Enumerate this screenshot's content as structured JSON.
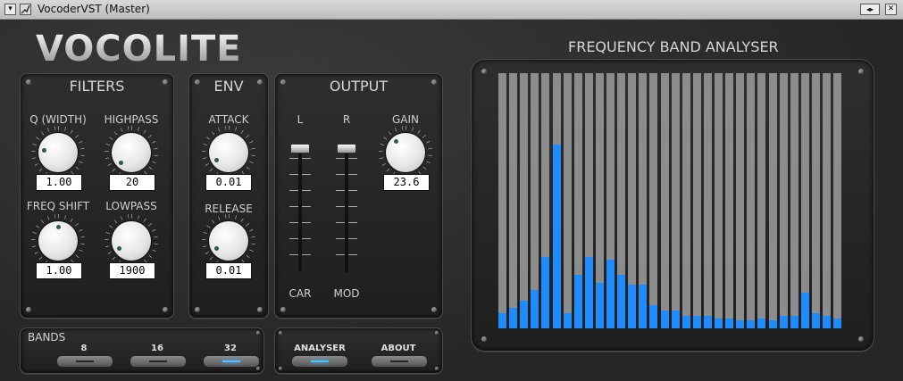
{
  "window": {
    "title": "VocoderVST (Master)",
    "menu_glyph": "▾",
    "resize_glyph": "◂▸",
    "close_glyph": "✕"
  },
  "logo": "VOCOLITE",
  "filters": {
    "title": "FILTERS",
    "q_label": "Q (WIDTH)",
    "q_value": "1.00",
    "q_level": 0.2,
    "highpass_label": "HIGHPASS",
    "highpass_value": "20",
    "highpass_level": 0.0,
    "freqshift_label": "FREQ SHIFT",
    "freqshift_value": "1.00",
    "freqshift_level": 0.5,
    "lowpass_label": "LOWPASS",
    "lowpass_value": "1900",
    "lowpass_level": 0.05
  },
  "env": {
    "title": "ENV",
    "attack_label": "ATTACK",
    "attack_value": "0.01",
    "attack_level": 0.05,
    "release_label": "RELEASE",
    "release_value": "0.01",
    "release_level": 0.05
  },
  "output": {
    "title": "OUTPUT",
    "l_label": "L",
    "r_label": "R",
    "gain_label": "GAIN",
    "gain_value": "23.6",
    "gain_level": 0.35,
    "car_label": "CAR",
    "mod_label": "MOD",
    "l_level": 1.0,
    "r_level": 1.0
  },
  "bands": {
    "title": "BANDS",
    "options": [
      "8",
      "16",
      "32"
    ],
    "selected": "32"
  },
  "view": {
    "analyser_label": "ANALYSER",
    "about_label": "ABOUT",
    "selected": "ANALYSER"
  },
  "analyser": {
    "title": "FREQUENCY BAND ANALYSER",
    "band_levels": [
      0.06,
      0.08,
      0.11,
      0.15,
      0.28,
      0.72,
      0.06,
      0.21,
      0.28,
      0.18,
      0.27,
      0.21,
      0.17,
      0.17,
      0.09,
      0.07,
      0.07,
      0.05,
      0.05,
      0.05,
      0.04,
      0.04,
      0.03,
      0.03,
      0.04,
      0.03,
      0.05,
      0.05,
      0.14,
      0.06,
      0.05,
      0.04
    ]
  },
  "colors": {
    "accent": "#1e8cff",
    "indicator_on": "#4fc0ff",
    "bar_background": "#8c8c8c"
  }
}
